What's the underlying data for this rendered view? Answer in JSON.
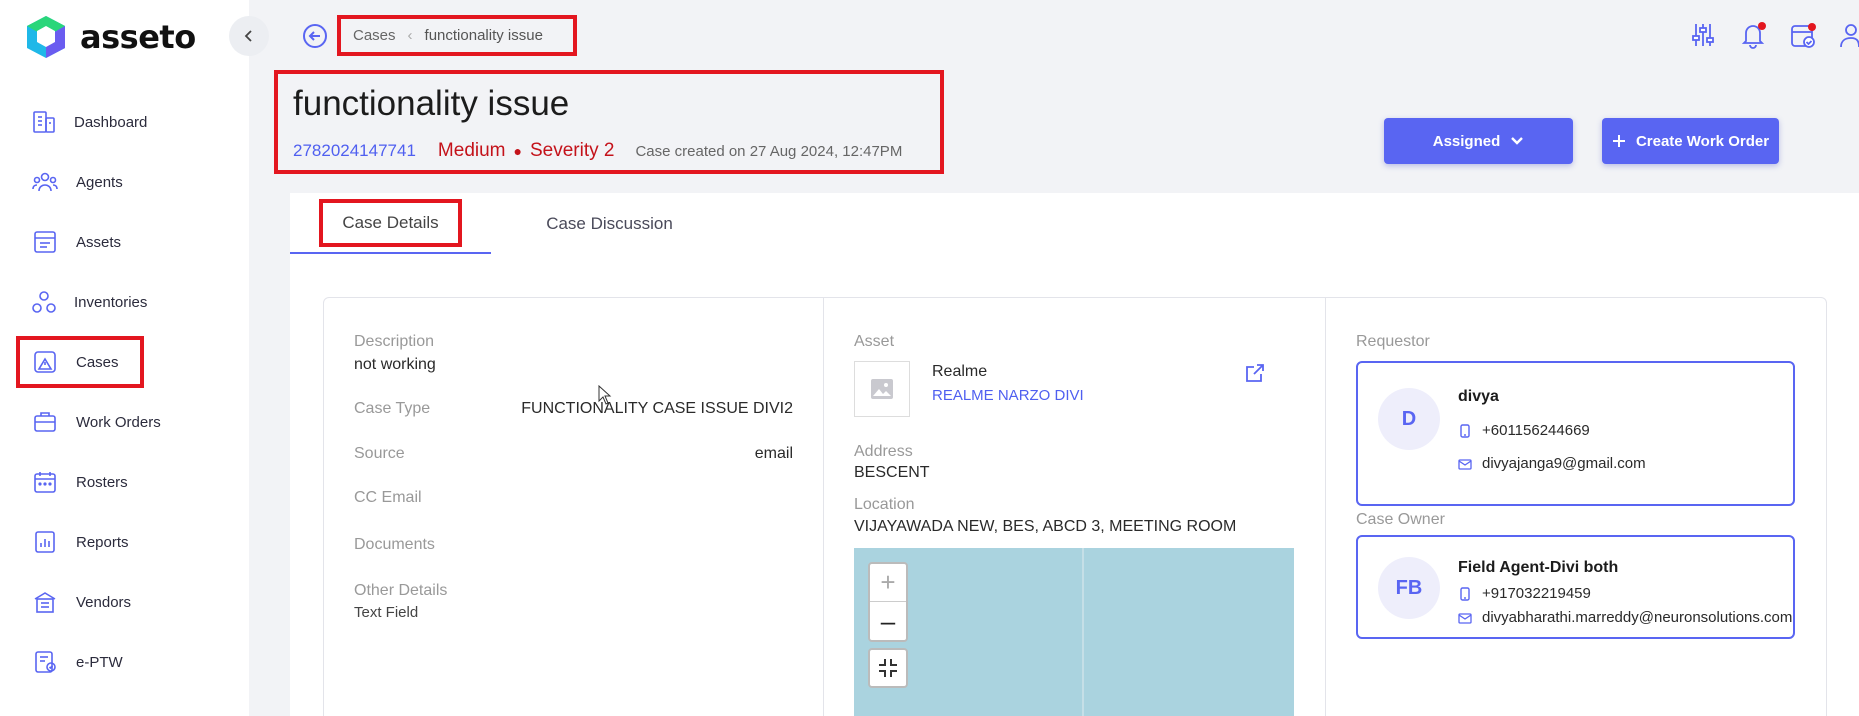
{
  "app": {
    "name": "asseto",
    "brand_color": "#5965f2",
    "highlight_color": "#e3161f"
  },
  "sidebar": {
    "collapse_icon": "chevron-left-icon",
    "items": [
      {
        "label": "Dashboard",
        "icon": "building-icon"
      },
      {
        "label": "Agents",
        "icon": "users-icon"
      },
      {
        "label": "Assets",
        "icon": "assets-grid-icon"
      },
      {
        "label": "Inventories",
        "icon": "inventory-circles-icon"
      },
      {
        "label": "Cases",
        "icon": "case-alert-icon",
        "active": true
      },
      {
        "label": "Work Orders",
        "icon": "briefcase-icon"
      },
      {
        "label": "Rosters",
        "icon": "calendar-icon"
      },
      {
        "label": "Reports",
        "icon": "report-chart-icon"
      },
      {
        "label": "Vendors",
        "icon": "vendor-building-icon"
      },
      {
        "label": "e-PTW",
        "icon": "permit-icon"
      }
    ]
  },
  "header": {
    "breadcrumb": {
      "parent": "Cases",
      "current": "functionality issue"
    },
    "icons": [
      "filter-sliders-icon",
      "notification-bell-icon",
      "calendar-check-icon",
      "user-profile-icon"
    ]
  },
  "case": {
    "title": "functionality issue",
    "id": "2782024147741",
    "priority": "Medium",
    "severity": "Severity 2",
    "created": "Case created on 27 Aug 2024, 12:47PM"
  },
  "actions": {
    "status_label": "Assigned",
    "create_label": "Create Work Order"
  },
  "tabs": [
    {
      "label": "Case Details",
      "active": true
    },
    {
      "label": "Case Discussion",
      "active": false
    }
  ],
  "details": {
    "description_label": "Description",
    "description_value": "not working",
    "case_type_label": "Case Type",
    "case_type_value": "FUNCTIONALITY CASE ISSUE DIVI2",
    "source_label": "Source",
    "source_value": "email",
    "cc_email_label": "CC Email",
    "documents_label": "Documents",
    "other_details_label": "Other Details",
    "other_details_value": "Text Field"
  },
  "asset": {
    "label": "Asset",
    "name": "Realme",
    "model": "REALME NARZO DIVI",
    "address_label": "Address",
    "address_value": "BESCENT",
    "location_label": "Location",
    "location_value": "VIJAYAWADA NEW, BES, ABCD 3, MEETING ROOM",
    "map": {
      "zoom_in": "+",
      "zoom_out": "–"
    }
  },
  "requestor": {
    "label": "Requestor",
    "initials": "D",
    "name": "divya",
    "phone": "+601156244669",
    "email": "divyajanga9@gmail.com"
  },
  "case_owner": {
    "label": "Case Owner",
    "initials": "FB",
    "name": "Field Agent-Divi both",
    "phone": "+917032219459",
    "email": "divyabharathi.marreddy@neuronsolutions.com"
  }
}
